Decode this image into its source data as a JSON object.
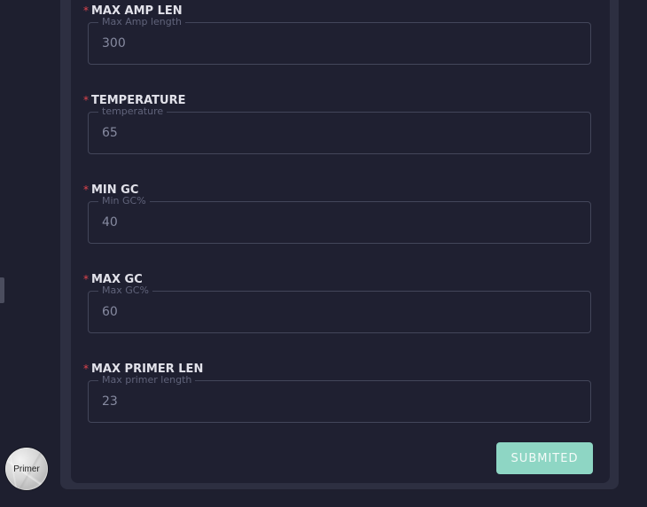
{
  "form": {
    "fields": [
      {
        "label": "MAX AMP LEN",
        "required_mark": "*",
        "legend": "Max Amp length",
        "value": "300"
      },
      {
        "label": "TEMPERATURE",
        "required_mark": "*",
        "legend": "temperature",
        "value": "65"
      },
      {
        "label": "MIN GC",
        "required_mark": "*",
        "legend": "Min GC%",
        "value": "40"
      },
      {
        "label": "MAX GC",
        "required_mark": "*",
        "legend": "Max GC%",
        "value": "60"
      },
      {
        "label": "MAX PRIMER LEN",
        "required_mark": "*",
        "legend": "Max primer length",
        "value": "23"
      }
    ],
    "submit_label": "SUBMITED"
  },
  "avatar": {
    "label": "Primer"
  },
  "colors": {
    "background": "#1e1f2f",
    "card": "#1f2031",
    "panel": "#2d2f41",
    "accent": "#8ed6c4",
    "required": "#e0444d"
  }
}
